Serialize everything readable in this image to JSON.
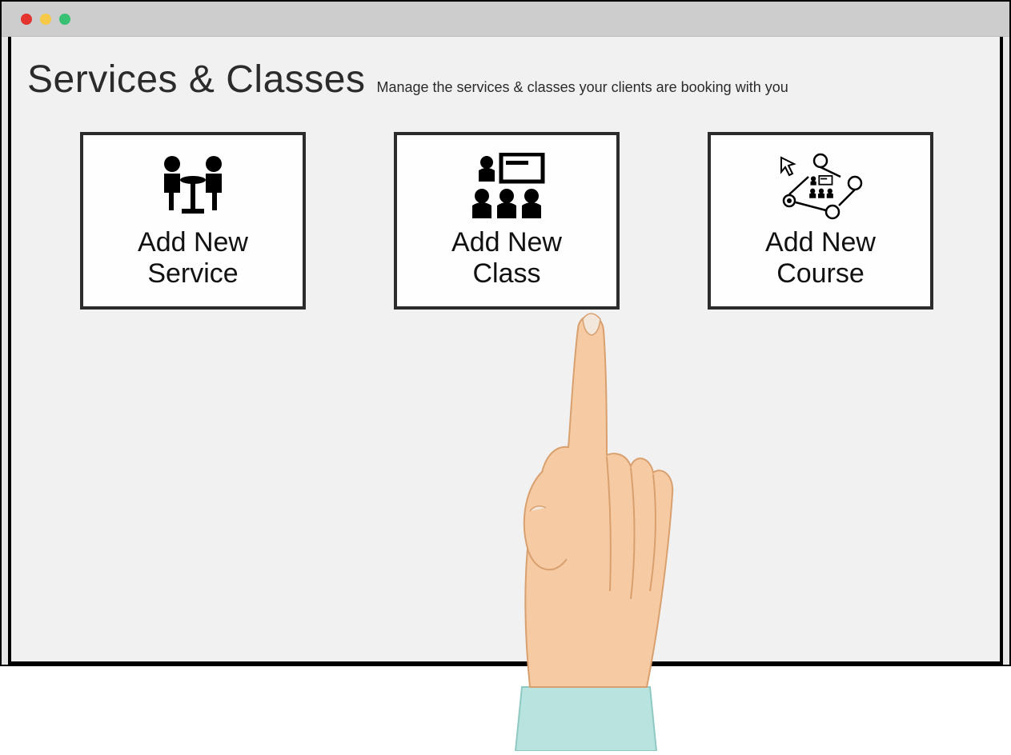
{
  "header": {
    "title": "Services & Classes",
    "subtitle": "Manage the services & classes your clients are booking with you"
  },
  "cards": [
    {
      "label": "Add New\nService",
      "icon": "meeting-icon"
    },
    {
      "label": "Add New\nClass",
      "icon": "class-icon"
    },
    {
      "label": "Add New\nCourse",
      "icon": "course-network-icon"
    }
  ],
  "window": {
    "traffic_lights": [
      "red",
      "yellow",
      "green"
    ]
  }
}
